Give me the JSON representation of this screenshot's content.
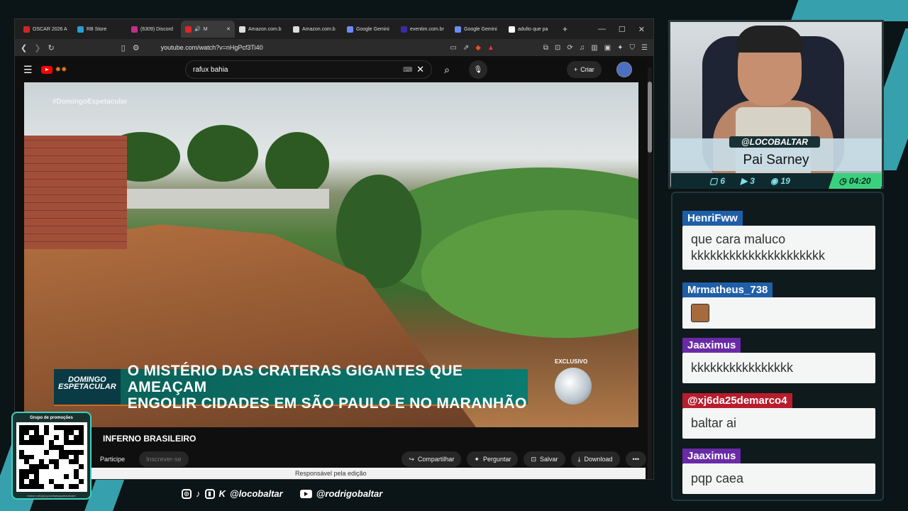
{
  "browser": {
    "tabs": [
      {
        "label": "OSCAR 2026 A",
        "color": "#d12626",
        "active": false
      },
      {
        "label": "RB Store",
        "color": "#2a9bd8",
        "active": false
      },
      {
        "label": "(6309) Discord",
        "color": "#c12e8e",
        "active": false
      },
      {
        "label": "M",
        "color": "#e02626",
        "active": true
      },
      {
        "label": "Amazon.com.b",
        "color": "#dddddd",
        "active": false
      },
      {
        "label": "Amazon.com.b",
        "color": "#dddddd",
        "active": false
      },
      {
        "label": "Google Gemini",
        "color": "#6b8cf2",
        "active": false
      },
      {
        "label": "eventim.com.br",
        "color": "#3a2aa8",
        "active": false
      },
      {
        "label": "Google Gemini",
        "color": "#6b8cf2",
        "active": false
      },
      {
        "label": "adulto que pa",
        "color": "#ffffff",
        "active": false
      }
    ],
    "url": "youtube.com/watch?v=nHgPcf3Ti40"
  },
  "youtube": {
    "search_value": "rafux bahia",
    "create_label": "Criar",
    "video_title": "INFERNO BRASILEIRO",
    "join_label": "Participe",
    "subscribe_label": "Inscrever-se",
    "share_label": "Compartilhar",
    "ask_label": "Perguntar",
    "save_label": "Salvar",
    "download_label": "Download",
    "editor_note": "Responsável pela edição"
  },
  "video": {
    "hashtag": "#DomingoEspetacular",
    "brand": "DOMINGO ESPETACULAR",
    "headline_1": "O MISTÉRIO DAS CRATERAS GIGANTES QUE AMEAÇAM",
    "headline_2": "ENGOLIR CIDADES EM SÃO PAULO E NO MARANHÃO",
    "exclusive": "EXCLUSIVO"
  },
  "promo": {
    "title": "Grupo de promoções",
    "footer": "rbstore.net/groups/whatsapp/hardware"
  },
  "social": {
    "handle1": "@locobaltar",
    "handle2": "@rodrigobaltar"
  },
  "stream": {
    "handle": "@LOCOBALTAR",
    "name": "Pai Sarney",
    "chat_count": "6",
    "video_count": "3",
    "viewers": "19",
    "timer": "04:20"
  },
  "chat": [
    {
      "user": "HenriFww",
      "color": "#1f5fa8",
      "text": "que cara maluco kkkkkkkkkkkkkkkkkkkkk"
    },
    {
      "user": "Mrmatheus_738",
      "color": "#1f5fa8",
      "text": ""
    },
    {
      "user": "Jaaximus",
      "color": "#6a2aa8",
      "text": "kkkkkkkkkkkkkkkk"
    },
    {
      "user": "@xj6da25demarco4",
      "color": "#b81d2e",
      "text": "baltar ai"
    },
    {
      "user": "Jaaximus",
      "color": "#6a2aa8",
      "text": "pqp caea"
    }
  ]
}
